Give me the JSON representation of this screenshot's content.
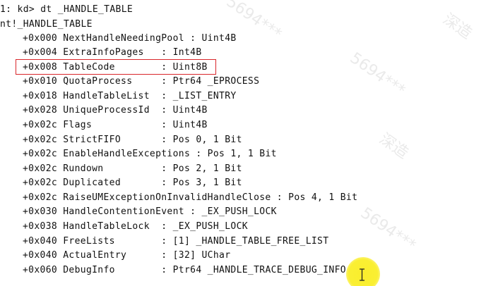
{
  "console": {
    "command_line": "1: kd> dt _HANDLE_TABLE",
    "type_header": "nt!_HANDLE_TABLE",
    "fields": [
      {
        "offset": "+0x000",
        "name": "NextHandleNeedingPool",
        "sep": " : ",
        "type": "Uint4B"
      },
      {
        "offset": "+0x004",
        "name": "ExtraInfoPages",
        "sep": "   : ",
        "type": "Int4B"
      },
      {
        "offset": "+0x008",
        "name": "TableCode",
        "sep": "        : ",
        "type": "Uint8B"
      },
      {
        "offset": "+0x010",
        "name": "QuotaProcess",
        "sep": "     : ",
        "type": "Ptr64 _EPROCESS"
      },
      {
        "offset": "+0x018",
        "name": "HandleTableList",
        "sep": "  : ",
        "type": "_LIST_ENTRY"
      },
      {
        "offset": "+0x028",
        "name": "UniqueProcessId",
        "sep": "  : ",
        "type": "Uint4B"
      },
      {
        "offset": "+0x02c",
        "name": "Flags",
        "sep": "            : ",
        "type": "Uint4B"
      },
      {
        "offset": "+0x02c",
        "name": "StrictFIFO",
        "sep": "       : ",
        "type": "Pos 0, 1 Bit"
      },
      {
        "offset": "+0x02c",
        "name": "EnableHandleExceptions",
        "sep": " : ",
        "type": "Pos 1, 1 Bit"
      },
      {
        "offset": "+0x02c",
        "name": "Rundown",
        "sep": "          : ",
        "type": "Pos 2, 1 Bit"
      },
      {
        "offset": "+0x02c",
        "name": "Duplicated",
        "sep": "       : ",
        "type": "Pos 3, 1 Bit"
      },
      {
        "offset": "+0x02c",
        "name": "RaiseUMExceptionOnInvalidHandleClose",
        "sep": " : ",
        "type": "Pos 4, 1 Bit"
      },
      {
        "offset": "+0x030",
        "name": "HandleContentionEvent",
        "sep": " : ",
        "type": "_EX_PUSH_LOCK"
      },
      {
        "offset": "+0x038",
        "name": "HandleTableLock",
        "sep": "  : ",
        "type": "_EX_PUSH_LOCK"
      },
      {
        "offset": "+0x040",
        "name": "FreeLists",
        "sep": "        : ",
        "type": "[1] _HANDLE_TABLE_FREE_LIST"
      },
      {
        "offset": "+0x040",
        "name": "ActualEntry",
        "sep": "      : ",
        "type": "[32] UChar"
      },
      {
        "offset": "+0x060",
        "name": "DebugInfo",
        "sep": "        : ",
        "type": "Ptr64 _HANDLE_TRACE_DEBUG_INFO"
      }
    ],
    "highlighted_field": "TableCode",
    "highlight_color": "#d9262a",
    "cursor_highlight_color": "#faee28"
  },
  "watermark": {
    "texts": [
      "5694***",
      "深造",
      "5694***",
      "深造",
      "5694***"
    ]
  }
}
